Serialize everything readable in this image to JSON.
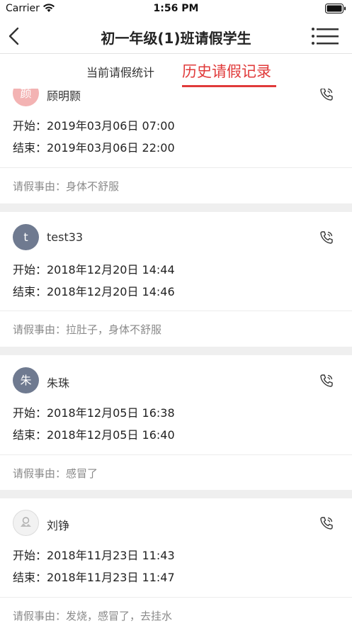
{
  "status_bar": {
    "carrier": "Carrier",
    "time": "1:56 PM"
  },
  "nav": {
    "title": "初一年级(1)班请假学生"
  },
  "tabs": {
    "current": "当前请假统计",
    "history": "历史请假记录"
  },
  "records": [
    {
      "name": "顾明颢",
      "avatar": "颜",
      "start": "开始：2019年03月06日 07:00",
      "end": "结束：2019年03月06日 22:00",
      "reason": "请假事由：身体不舒服"
    },
    {
      "name": "test33",
      "avatar": "t",
      "start": "开始：2018年12月20日 14:44",
      "end": "结束：2018年12月20日 14:46",
      "reason": "请假事由：拉肚子，身体不舒服"
    },
    {
      "name": "朱珠",
      "avatar": "朱",
      "start": "开始：2018年12月05日 16:38",
      "end": "结束：2018年12月05日 16:40",
      "reason": "请假事由：感冒了"
    },
    {
      "name": "刘铮",
      "avatar": "",
      "start": "开始：2018年11月23日 11:43",
      "end": "结束：2018年11月23日 11:47",
      "reason": "请假事由：发烧，感冒了，去挂水"
    }
  ],
  "colors": {
    "accent": "#e03a3a",
    "avatar_pink": "#f3b3b3",
    "avatar_slate": "#6f7a90"
  },
  "icons": {
    "back": "chevron-left-icon",
    "menu": "menu-icon",
    "phone": "phone-icon"
  }
}
